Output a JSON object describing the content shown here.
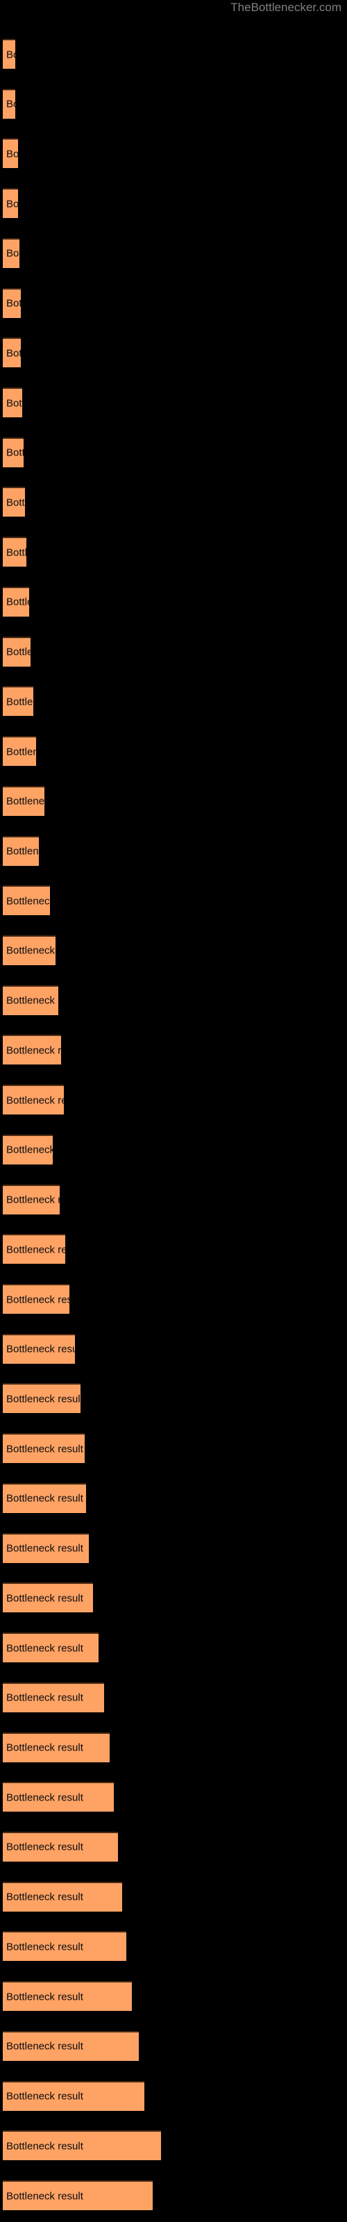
{
  "header": {
    "site_title": "TheBottlenecker.com"
  },
  "colors": {
    "background": "#000000",
    "bar_fill": "#ffa365",
    "bar_top_edge": "#4a2a14",
    "bar_label_text": "#0d0d0d",
    "title_text": "#808080"
  },
  "chart_data": {
    "type": "bar",
    "orientation": "horizontal",
    "title": "TheBottlenecker.com",
    "xlabel": "",
    "ylabel": "",
    "grid": false,
    "legend": null,
    "bar_label": "Bottleneck result",
    "categories": [
      "Bottleneck result",
      "Bottleneck result",
      "Bottleneck result",
      "Bottleneck result",
      "Bottleneck result",
      "Bottleneck result",
      "Bottleneck result",
      "Bottleneck result",
      "Bottleneck result",
      "Bottleneck result",
      "Bottleneck result",
      "Bottleneck result",
      "Bottleneck result",
      "Bottleneck result",
      "Bottleneck result",
      "Bottleneck result",
      "Bottleneck result",
      "Bottleneck result",
      "Bottleneck result",
      "Bottleneck result",
      "Bottleneck result",
      "Bottleneck result",
      "Bottleneck result",
      "Bottleneck result",
      "Bottleneck result",
      "Bottleneck result",
      "Bottleneck result",
      "Bottleneck result",
      "Bottleneck result",
      "Bottleneck result",
      "Bottleneck result",
      "Bottleneck result",
      "Bottleneck result",
      "Bottleneck result",
      "Bottleneck result",
      "Bottleneck result",
      "Bottleneck result",
      "Bottleneck result",
      "Bottleneck result",
      "Bottleneck result",
      "Bottleneck result",
      "Bottleneck result",
      "Bottleneck result",
      "Bottleneck result"
    ],
    "values": [
      18,
      18,
      22,
      22,
      24,
      26,
      26,
      28,
      30,
      32,
      34,
      38,
      40,
      44,
      48,
      60,
      52,
      68,
      76,
      80,
      84,
      88,
      72,
      82,
      90,
      96,
      104,
      112,
      118,
      120,
      124,
      130,
      138,
      146,
      154,
      160,
      166,
      172,
      178,
      186,
      196,
      204,
      228,
      216
    ],
    "value_unit": "px",
    "xlim": [
      0,
      500
    ],
    "bar_top_y": [
      56,
      99,
      142,
      185,
      228,
      271,
      314,
      357,
      400,
      443,
      486,
      529,
      572,
      615,
      658,
      701,
      744,
      787,
      830,
      873,
      916,
      959,
      1002,
      1045,
      1088,
      1131,
      1174,
      1217,
      1260,
      1303,
      1346,
      1389,
      1432,
      1475,
      1518,
      1561,
      1604,
      1647,
      1690,
      1733,
      1776,
      1819,
      1862,
      1905
    ]
  }
}
